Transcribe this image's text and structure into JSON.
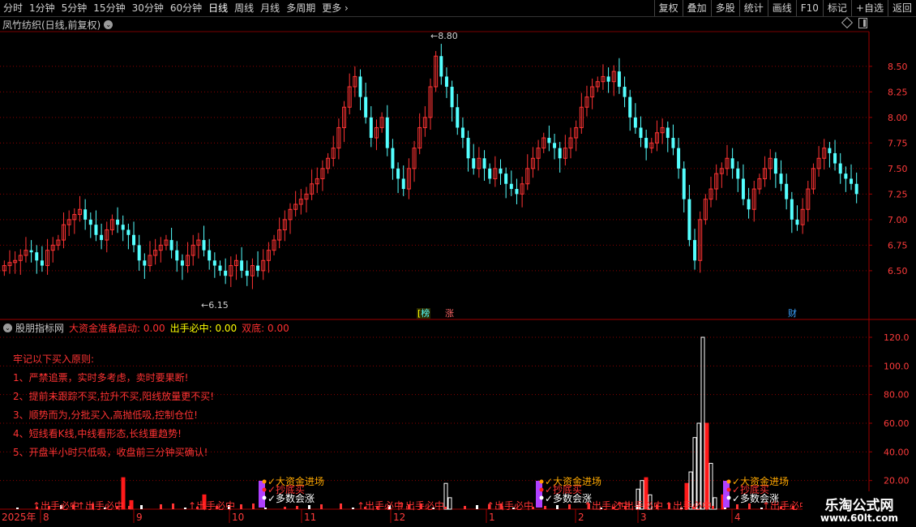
{
  "toolbar": {
    "periods": [
      "分时",
      "1分钟",
      "5分钟",
      "15分钟",
      "30分钟",
      "60分钟",
      "日线",
      "周线",
      "月线",
      "多周期",
      "更多"
    ],
    "active_period": "日线",
    "buttons": [
      "复权",
      "叠加",
      "多股",
      "统计",
      "画线",
      "F10",
      "标记",
      "+自选",
      "返回"
    ]
  },
  "stock": {
    "title": "凤竹纺织(日线,前复权)",
    "high_label": "8.80",
    "low_label": "6.15"
  },
  "markers": {
    "bang": "榜",
    "zhang": "涨",
    "cai": "财"
  },
  "indicator": {
    "name": "股朋指标网",
    "v1": "大资金准备启动: 0.00",
    "v2": "出手必中: 0.00",
    "v3": "双底: 0.00"
  },
  "rules": {
    "title": "牢记以下买入原则:",
    "items": [
      "1、严禁追票，实时多考虑，卖时要果断!",
      "2、提前未跟踪不买,拉升不买,阳线放量更不买!",
      "3、顺势而为,分批买入,高抛低吸,控制仓位!",
      "4、短线看K线,中线看形态,长线重趋势!",
      "5、开盘半小时只低吸，收盘前三分钟买确认!"
    ]
  },
  "signals": {
    "big_money": "大资金进场",
    "buy_now": "抄底买",
    "bull_up": "多数会涨",
    "shoot": "出手必中"
  },
  "date_axis": {
    "year": "2025年",
    "months": [
      "8",
      "9",
      "10",
      "11",
      "12",
      "1",
      "2",
      "3",
      "4"
    ]
  },
  "price_axis": [
    "8.50",
    "8.25",
    "8.00",
    "7.75",
    "7.50",
    "7.25",
    "7.00",
    "6.75",
    "6.50"
  ],
  "ind_axis": [
    "120.0",
    "100.0",
    "80.00",
    "60.00",
    "40.00",
    "20.00"
  ],
  "watermark": {
    "title": "乐淘公式网",
    "url": "www.60lt.com"
  },
  "colors": {
    "up": "#ff3333",
    "down": "#54ffff",
    "grid": "#8b0000",
    "axis_text": "#ff3b3b"
  },
  "chart_data": {
    "type": "candlestick",
    "ylim": [
      6.15,
      8.8
    ],
    "series": [
      {
        "name": "close",
        "values": [
          6.55,
          6.58,
          6.6,
          6.65,
          6.7,
          6.68,
          6.6,
          6.55,
          6.7,
          6.75,
          6.8,
          6.95,
          7.0,
          7.05,
          7.1,
          7.0,
          6.95,
          6.85,
          6.8,
          6.9,
          7.0,
          6.95,
          6.9,
          6.85,
          6.75,
          6.6,
          6.55,
          6.65,
          6.7,
          6.75,
          6.8,
          6.7,
          6.6,
          6.55,
          6.65,
          6.75,
          6.8,
          6.7,
          6.6,
          6.55,
          6.5,
          6.45,
          6.55,
          6.6,
          6.5,
          6.45,
          6.55,
          6.5,
          6.6,
          6.7,
          6.8,
          6.9,
          7.0,
          7.1,
          7.15,
          7.2,
          7.25,
          7.35,
          7.4,
          7.5,
          7.6,
          7.7,
          7.9,
          8.1,
          8.3,
          8.4,
          8.2,
          8.0,
          7.8,
          7.9,
          8.0,
          7.7,
          7.5,
          7.4,
          7.3,
          7.5,
          7.7,
          7.9,
          8.0,
          8.3,
          8.6,
          8.4,
          8.3,
          8.1,
          7.9,
          7.8,
          7.6,
          7.5,
          7.6,
          7.5,
          7.4,
          7.5,
          7.45,
          7.35,
          7.3,
          7.25,
          7.35,
          7.5,
          7.6,
          7.7,
          7.8,
          7.75,
          7.7,
          7.6,
          7.7,
          7.8,
          7.9,
          8.1,
          8.2,
          8.3,
          8.35,
          8.4,
          8.35,
          8.45,
          8.3,
          8.2,
          8.0,
          7.9,
          7.8,
          7.7,
          7.75,
          7.85,
          7.9,
          7.8,
          7.7,
          7.5,
          7.2,
          6.8,
          6.6,
          7.0,
          7.2,
          7.3,
          7.45,
          7.5,
          7.6,
          7.5,
          7.4,
          7.2,
          7.1,
          7.3,
          7.4,
          7.5,
          7.6,
          7.45,
          7.35,
          7.2,
          7.0,
          6.95,
          7.1,
          7.3,
          7.5,
          7.6,
          7.7,
          7.65,
          7.55,
          7.45,
          7.4,
          7.35,
          7.25
        ]
      }
    ]
  }
}
